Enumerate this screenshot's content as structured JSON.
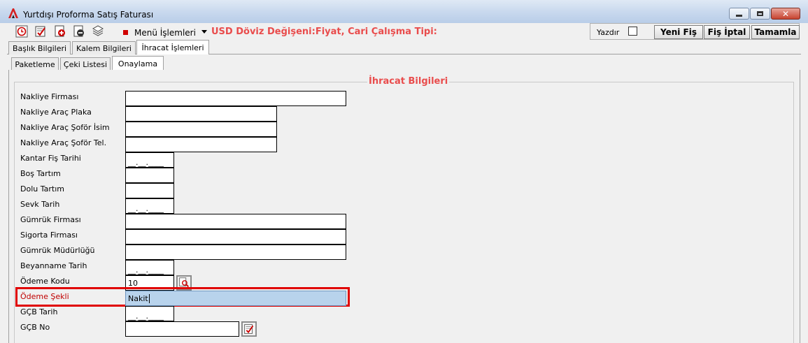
{
  "window": {
    "title": "Yurtdışı Proforma Satış Faturası",
    "close_glyph": "✕",
    "logo_icon": "app-logo-icon",
    "accent_red": "#e94c4c"
  },
  "toolbar": {
    "icons": [
      "clock-icon",
      "edit-check-icon",
      "add-document-icon",
      "remove-document-icon",
      "layers-icon"
    ],
    "menu_label": "Menü İşlemleri",
    "currency_info": "USD Döviz Değişeni:Fiyat, Cari Çalışma Tipi:",
    "print_label": "Yazdır",
    "print_checked": false,
    "new_button": "Yeni Fiş",
    "cancel_button": "Fiş İptal",
    "complete_button": "Tamamla"
  },
  "tabs_main": [
    {
      "label": "Başlık Bilgileri",
      "active": false
    },
    {
      "label": "Kalem Bilgileri",
      "active": false
    },
    {
      "label": "İhracat İşlemleri",
      "active": true
    }
  ],
  "tabs_sub": [
    {
      "label": "Paketleme",
      "active": false
    },
    {
      "label": "Çeki Listesi",
      "active": false
    },
    {
      "label": "Onaylama",
      "active": true
    }
  ],
  "section_title": "İhracat Bilgileri",
  "fields": {
    "nakliye_firmasi": {
      "label": "Nakliye Firması",
      "value": ""
    },
    "arac_plaka": {
      "label": "Nakliye Araç Plaka",
      "value": ""
    },
    "sofor_isim": {
      "label": "Nakliye Araç Şoför İsim",
      "value": ""
    },
    "sofor_tel": {
      "label": "Nakliye Araç Şoför Tel.",
      "value": ""
    },
    "kantar_tarih": {
      "label": "Kantar Fiş Tarihi",
      "value": "__.__.____"
    },
    "bos_tartim": {
      "label": "Boş Tartım",
      "value": ""
    },
    "dolu_tartim": {
      "label": "Dolu Tartım",
      "value": ""
    },
    "sevk_tarih": {
      "label": "Sevk Tarih",
      "value": "__.__.____"
    },
    "gumruk_firmasi": {
      "label": "Gümrük Firması",
      "value": ""
    },
    "sigorta_firmasi": {
      "label": "Sigorta Firması",
      "value": ""
    },
    "gumruk_mudurlugu": {
      "label": "Gümrük Müdürlüğü",
      "value": ""
    },
    "beyanname_tarih": {
      "label": "Beyanname Tarih",
      "value": "__.__.____"
    },
    "odeme_kodu": {
      "label": "Ödeme Kodu",
      "value": "10"
    },
    "odeme_sekli": {
      "label": "Ödeme Şekli",
      "value": "Nakit"
    },
    "gcb_tarih": {
      "label": "GÇB Tarih",
      "value": "__.__.____"
    },
    "gcb_no": {
      "label": "GÇB No",
      "value": ""
    }
  }
}
